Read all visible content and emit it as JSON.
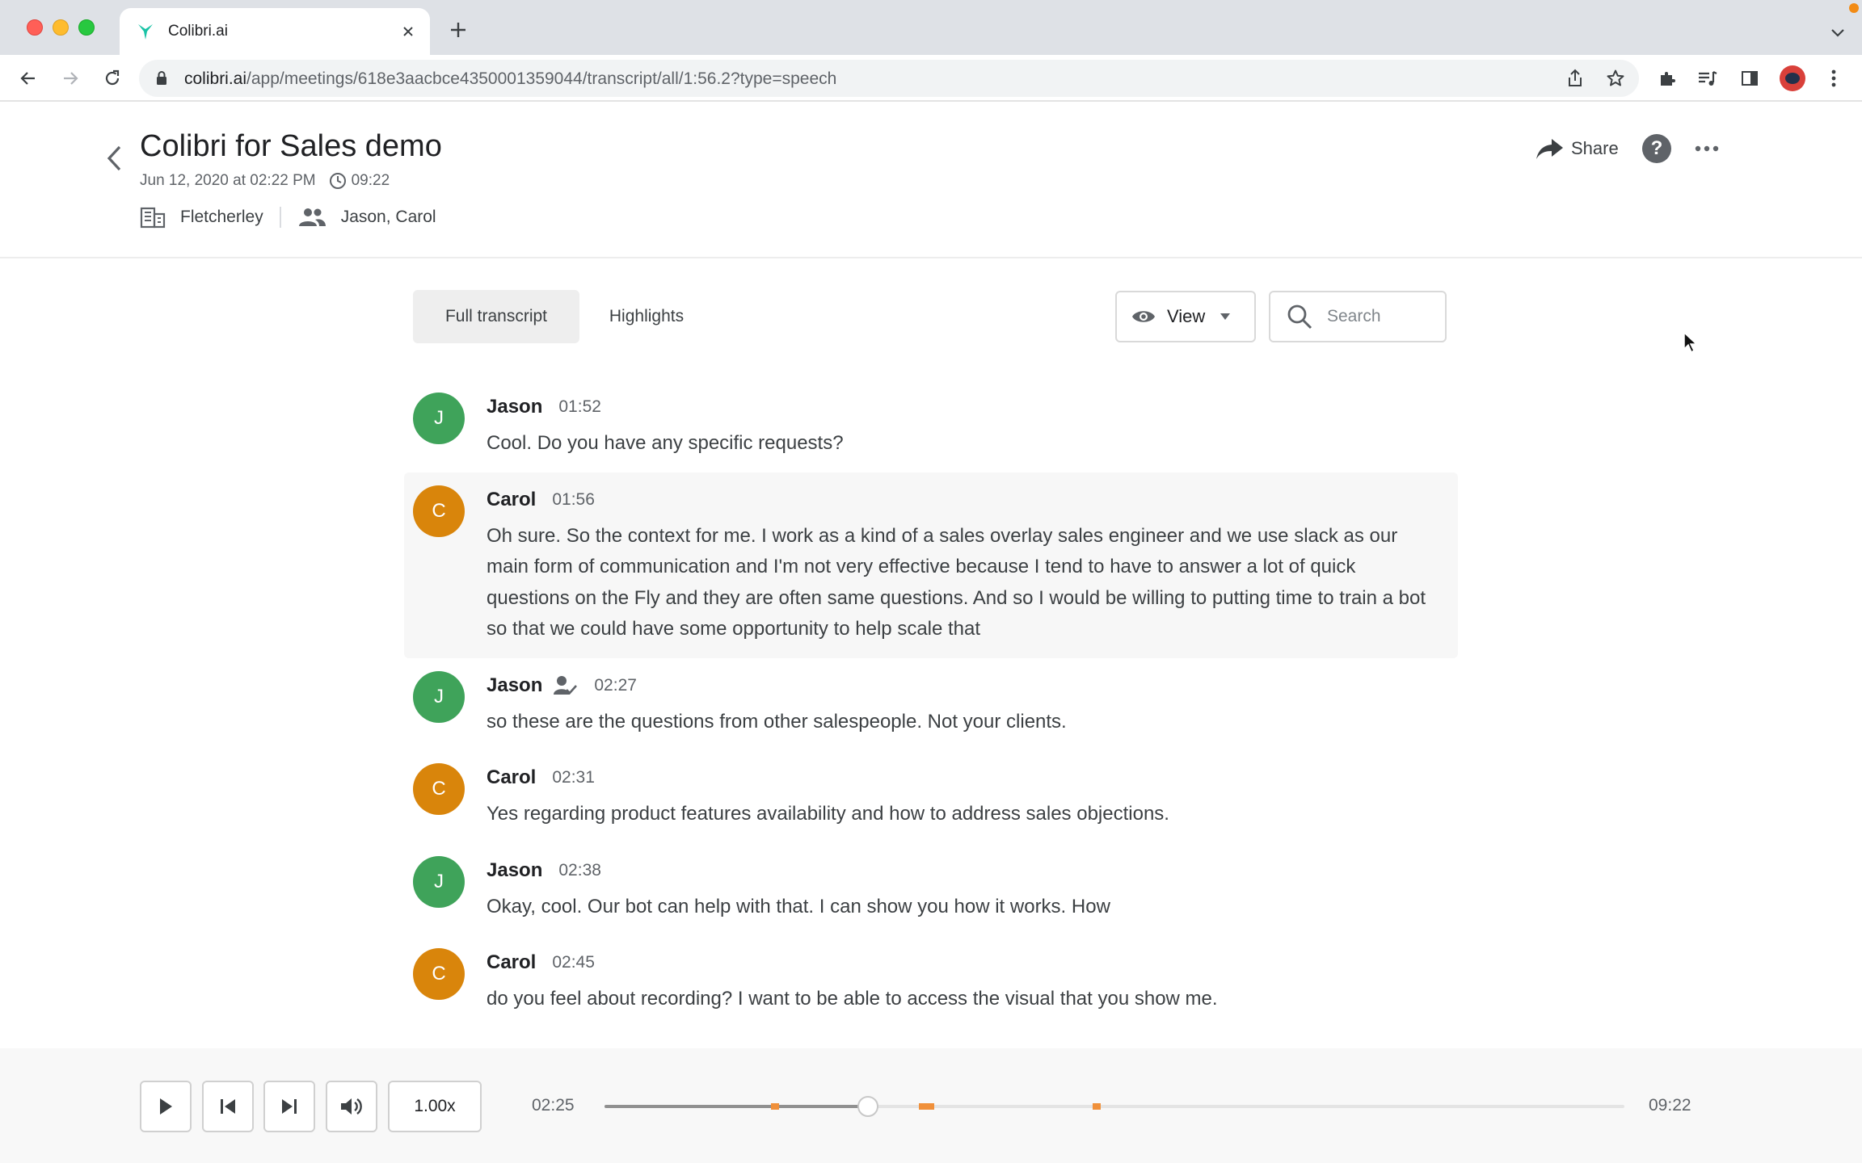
{
  "browser": {
    "tab_title": "Colibri.ai",
    "url_host": "colibri.ai",
    "url_path": "/app/meetings/618e3aacbce4350001359044/transcript/all/1:56.2?type=speech"
  },
  "meeting": {
    "title": "Colibri for Sales demo",
    "date": "Jun 12, 2020 at 02:22 PM",
    "duration": "09:22",
    "company": "Fletcherley",
    "participants": "Jason, Carol",
    "share_label": "Share"
  },
  "tabs": {
    "full_transcript": "Full transcript",
    "highlights": "Highlights"
  },
  "controls": {
    "view_label": "View",
    "search_placeholder": "Search"
  },
  "colors": {
    "jason_avatar": "#3fa35a",
    "carol_avatar": "#d9850b",
    "marker": "#f0903a"
  },
  "transcript": [
    {
      "initial": "J",
      "speaker": "Jason",
      "time": "01:52",
      "text": "Cool. Do you have any specific requests?",
      "verified": false,
      "active": false
    },
    {
      "initial": "C",
      "speaker": "Carol",
      "time": "01:56",
      "text": "Oh sure. So the context for me. I work as a kind of a sales overlay sales engineer and we use slack as our main form of communication and I'm not very effective because I tend to have to answer a lot of quick questions on the Fly and they are often same questions. And so I would be willing to putting time to train a bot so that we could have some opportunity to help scale that",
      "verified": false,
      "active": true
    },
    {
      "initial": "J",
      "speaker": "Jason",
      "time": "02:27",
      "text": "so these are the questions from other salespeople. Not your clients.",
      "verified": true,
      "active": false
    },
    {
      "initial": "C",
      "speaker": "Carol",
      "time": "02:31",
      "text": "Yes regarding product features availability and how to address sales objections.",
      "verified": false,
      "active": false
    },
    {
      "initial": "J",
      "speaker": "Jason",
      "time": "02:38",
      "text": "Okay, cool. Our bot can help with that. I can show you how it works. How",
      "verified": false,
      "active": false
    },
    {
      "initial": "C",
      "speaker": "Carol",
      "time": "02:45",
      "text": "do you feel about recording? I want to be able to access the visual that you show me.",
      "verified": false,
      "active": false
    }
  ],
  "player": {
    "speed": "1.00x",
    "current_time": "02:25",
    "total_time": "09:22",
    "progress": 0.258,
    "markers": [
      0.163,
      0.308,
      0.315,
      0.479
    ]
  }
}
